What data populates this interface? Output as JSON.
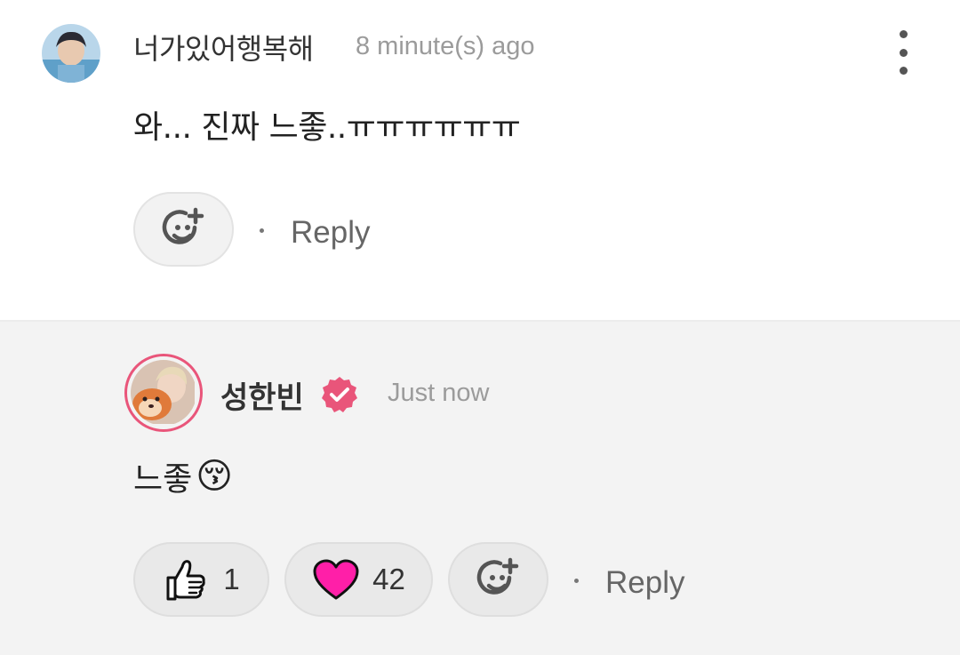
{
  "comment": {
    "username": "너가있어행복해",
    "time": "8 minute(s) ago",
    "text": "와... 진짜 느좋..ㅠㅠㅠㅠㅠㅠ",
    "reply_label": "Reply"
  },
  "reply_comment": {
    "username": "성한빈",
    "time": "Just now",
    "text": "느좋",
    "emoji": "😚",
    "likes": "1",
    "hearts": "42",
    "reply_label": "Reply"
  },
  "colors": {
    "accent_pink": "#e9557a",
    "heart": "#ff1fa8",
    "reply_bg": "#f3f3f3"
  },
  "icons": [
    "kebab-menu-icon",
    "add-reaction-icon",
    "thumbs-up-icon",
    "heart-icon",
    "verified-badge-icon"
  ]
}
